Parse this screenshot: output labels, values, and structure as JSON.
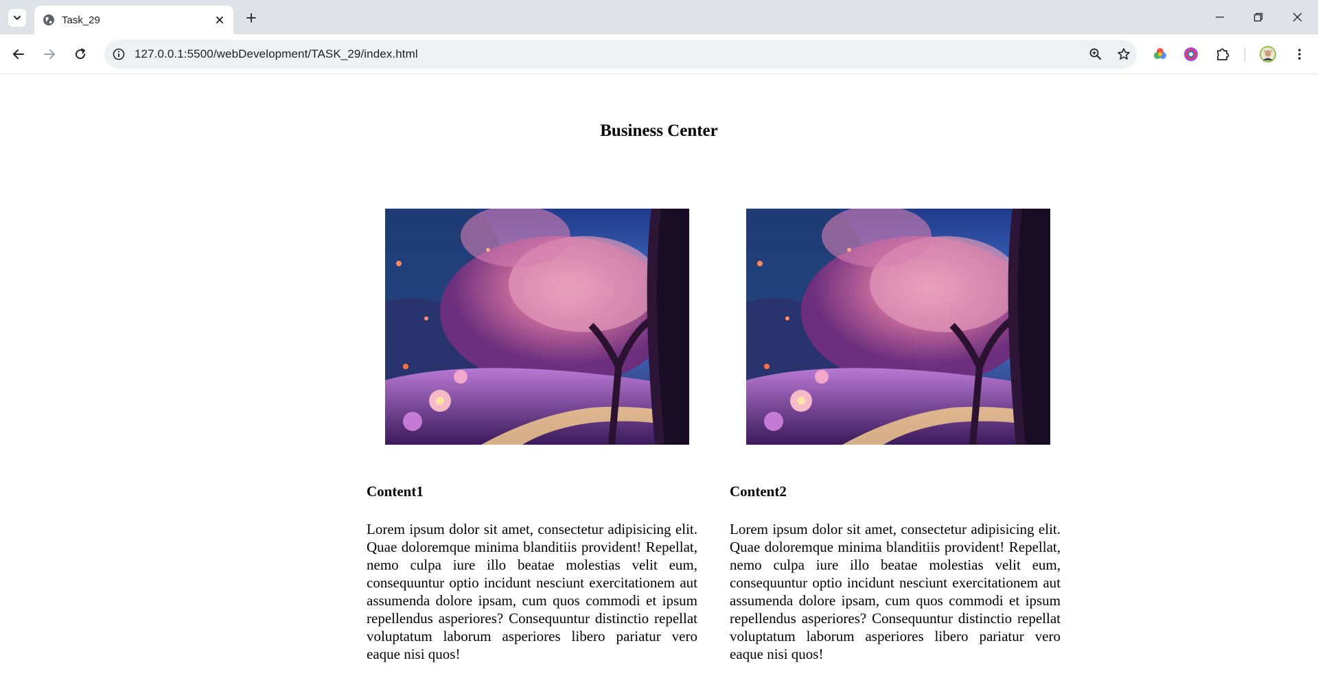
{
  "browser": {
    "tab": {
      "title": "Task_29"
    },
    "address_bar": {
      "url": "127.0.0.1:5500/webDevelopment/TASK_29/index.html"
    },
    "icons": {
      "tab_search": "chevron-down-icon",
      "favicon": "globe-icon",
      "tab_close": "close-icon",
      "new_tab": "plus-icon",
      "back": "arrow-left-icon",
      "forward": "arrow-right-icon",
      "reload": "reload-icon",
      "site_info": "info-icon",
      "zoom": "zoom-icon",
      "bookmark": "star-icon",
      "extensions": "puzzle-icon",
      "menu": "kebab-menu-icon"
    }
  },
  "page": {
    "title": "Business Center",
    "cards": [
      {
        "heading": "Content1",
        "text": "Lorem ipsum dolor sit amet, consectetur adipisicing elit. Quae doloremque minima blanditiis provident! Repellat, nemo culpa iure illo beatae molestias velit eum, consequuntur optio incidunt nesciunt exercitationem aut assumenda dolore ipsam, cum quos commodi et ipsum repellendus asperiores? Consequuntur distinctio repellat voluptatum laborum asperiores libero pariatur vero eaque nisi quos!",
        "image": "anime-cherry-blossom-landscape"
      },
      {
        "heading": "Content2",
        "text": "Lorem ipsum dolor sit amet, consectetur adipisicing elit. Quae doloremque minima blanditiis provident! Repellat, nemo culpa iure illo beatae molestias velit eum, consequuntur optio incidunt nesciunt exercitationem aut assumenda dolore ipsam, cum quos commodi et ipsum repellendus asperiores? Consequuntur distinctio repellat voluptatum laborum asperiores libero pariatur vero eaque nisi quos!",
        "image": "anime-cherry-blossom-landscape"
      }
    ]
  }
}
